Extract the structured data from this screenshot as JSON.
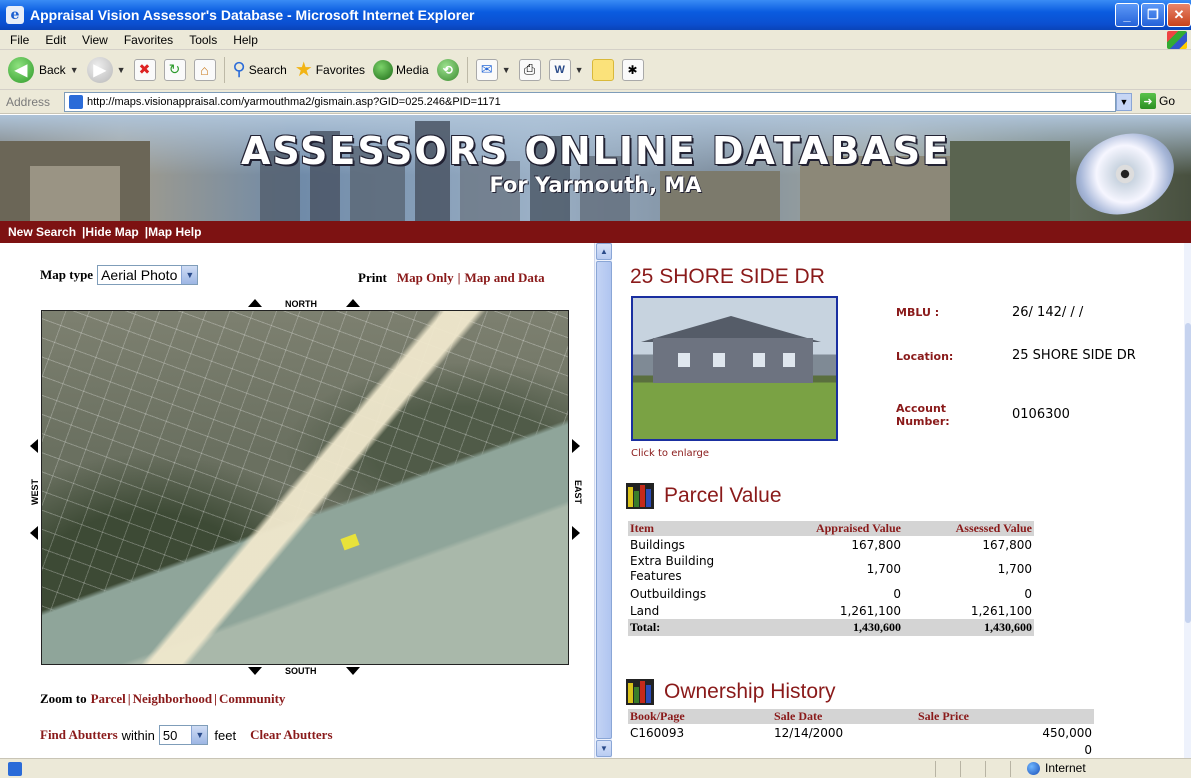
{
  "window": {
    "title": "Appraisal Vision Assessor's Database - Microsoft Internet Explorer"
  },
  "menu": [
    "File",
    "Edit",
    "View",
    "Favorites",
    "Tools",
    "Help"
  ],
  "toolbar": {
    "back_label": "Back",
    "search_label": "Search",
    "favorites_label": "Favorites",
    "media_label": "Media"
  },
  "address": {
    "label": "Address",
    "url": "http://maps.visionappraisal.com/yarmouthma2/gismain.asp?GID=025.246&PID=1171",
    "go_label": "Go"
  },
  "banner": {
    "title": "ASSESSORS ONLINE DATABASE",
    "subtitle": "For Yarmouth, MA"
  },
  "nav": {
    "new_search": "New Search",
    "hide_map": "|Hide Map",
    "map_help": "|Map Help"
  },
  "map": {
    "map_type_label": "Map type",
    "map_type_value": "Aerial Photo",
    "print_label": "Print",
    "map_only": "Map Only",
    "divider": "|",
    "map_and_data": "Map and Data",
    "north": "NORTH",
    "south": "SOUTH",
    "west": "WEST",
    "east": "EAST",
    "zoom_label": "Zoom to",
    "zoom_parcel": "Parcel",
    "zoom_neighborhood": "Neighborhood",
    "zoom_community": "Community",
    "find_abutters": "Find Abutters",
    "within": "within",
    "abutter_distance": "50",
    "feet": "feet",
    "clear_abutters": "Clear Abutters"
  },
  "property": {
    "address": "25 SHORE SIDE DR",
    "click_to_enlarge": "Click to enlarge",
    "mblu_label": "MBLU :",
    "mblu_value": "26/ 142/ / /",
    "location_label": "Location:",
    "location_value": "25 SHORE SIDE DR",
    "account_label": "Account Number:",
    "account_value": "0106300"
  },
  "parcel_value": {
    "title": "Parcel Value",
    "headers": [
      "Item",
      "Appraised Value",
      "Assessed Value"
    ],
    "rows": [
      {
        "item": "Buildings",
        "appraised": "167,800",
        "assessed": "167,800"
      },
      {
        "item": "Extra Building Features",
        "appraised": "1,700",
        "assessed": "1,700"
      },
      {
        "item": "Outbuildings",
        "appraised": "0",
        "assessed": "0"
      },
      {
        "item": "Land",
        "appraised": "1,261,100",
        "assessed": "1,261,100"
      }
    ],
    "total": {
      "item": "Total:",
      "appraised": "1,430,600",
      "assessed": "1,430,600"
    }
  },
  "ownership": {
    "title": "Ownership History",
    "headers": [
      "Book/Page",
      "Sale Date",
      "Sale Price"
    ],
    "rows": [
      {
        "book": "C160093",
        "date": "12/14/2000",
        "price": "450,000"
      },
      {
        "book": "",
        "date": "",
        "price": "0"
      }
    ]
  },
  "status": {
    "zone": "Internet"
  },
  "colors": {
    "accent": "#8a1a1a",
    "nav_bar": "#7d1212",
    "titlebar": "#0a5ce0"
  }
}
